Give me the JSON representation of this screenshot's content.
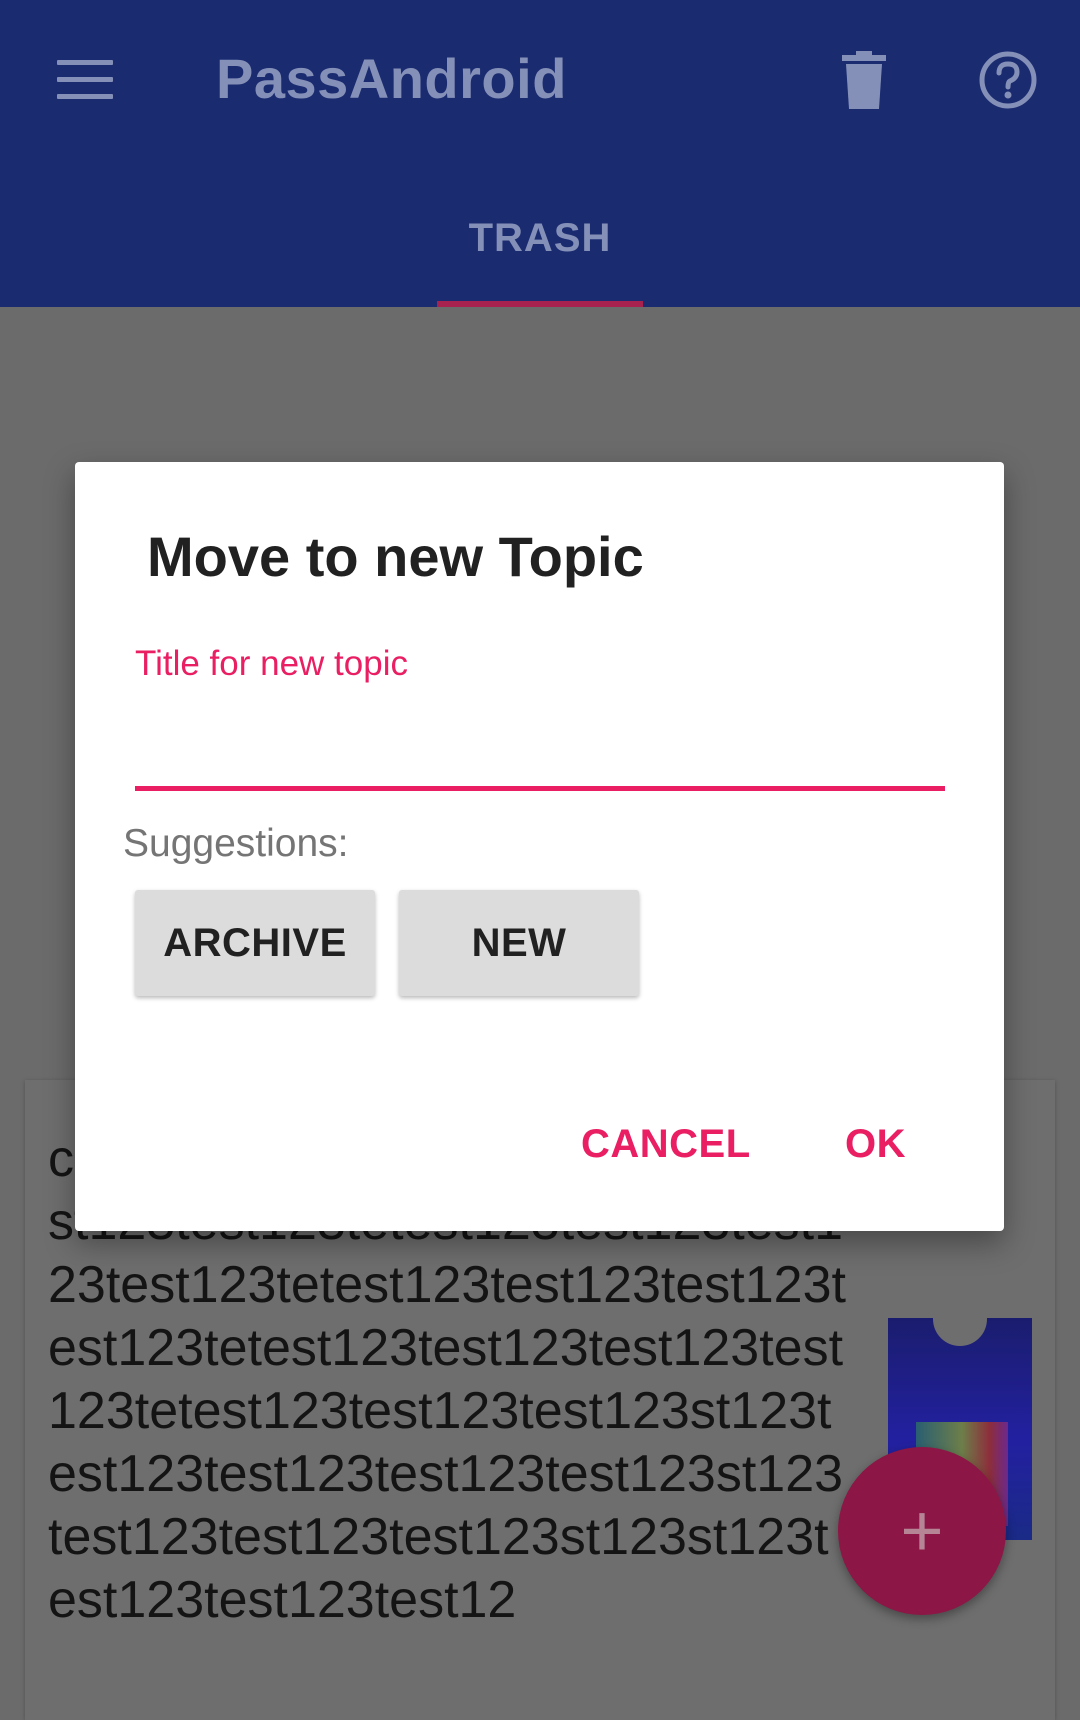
{
  "app_bar": {
    "title": "PassAndroid",
    "menu_icon": "menu-icon",
    "trash_icon": "trash-icon",
    "help_icon": "help-icon",
    "background": "#1a2b70"
  },
  "tabs": [
    {
      "label": "TRASH",
      "selected": true
    }
  ],
  "dialog": {
    "title": "Move to new Topic",
    "input_label": "Title for new topic",
    "input_value": "",
    "suggestions_label": "Suggestions:",
    "suggestions": [
      "ARCHIVE",
      "NEW"
    ],
    "cancel_label": "CANCEL",
    "ok_label": "OK",
    "accent": "#e91e63"
  },
  "background_card": {
    "text": "c Passtest123testtest123test123test123test123tetest123test123test123test123tetest123test123test123test123tetest123test123test123test123tetest123test123test123st123test123test123test123test123st123test123test123test123st123st123test123test123test12"
  },
  "fab": {
    "label": "+",
    "icon": "add-icon"
  }
}
